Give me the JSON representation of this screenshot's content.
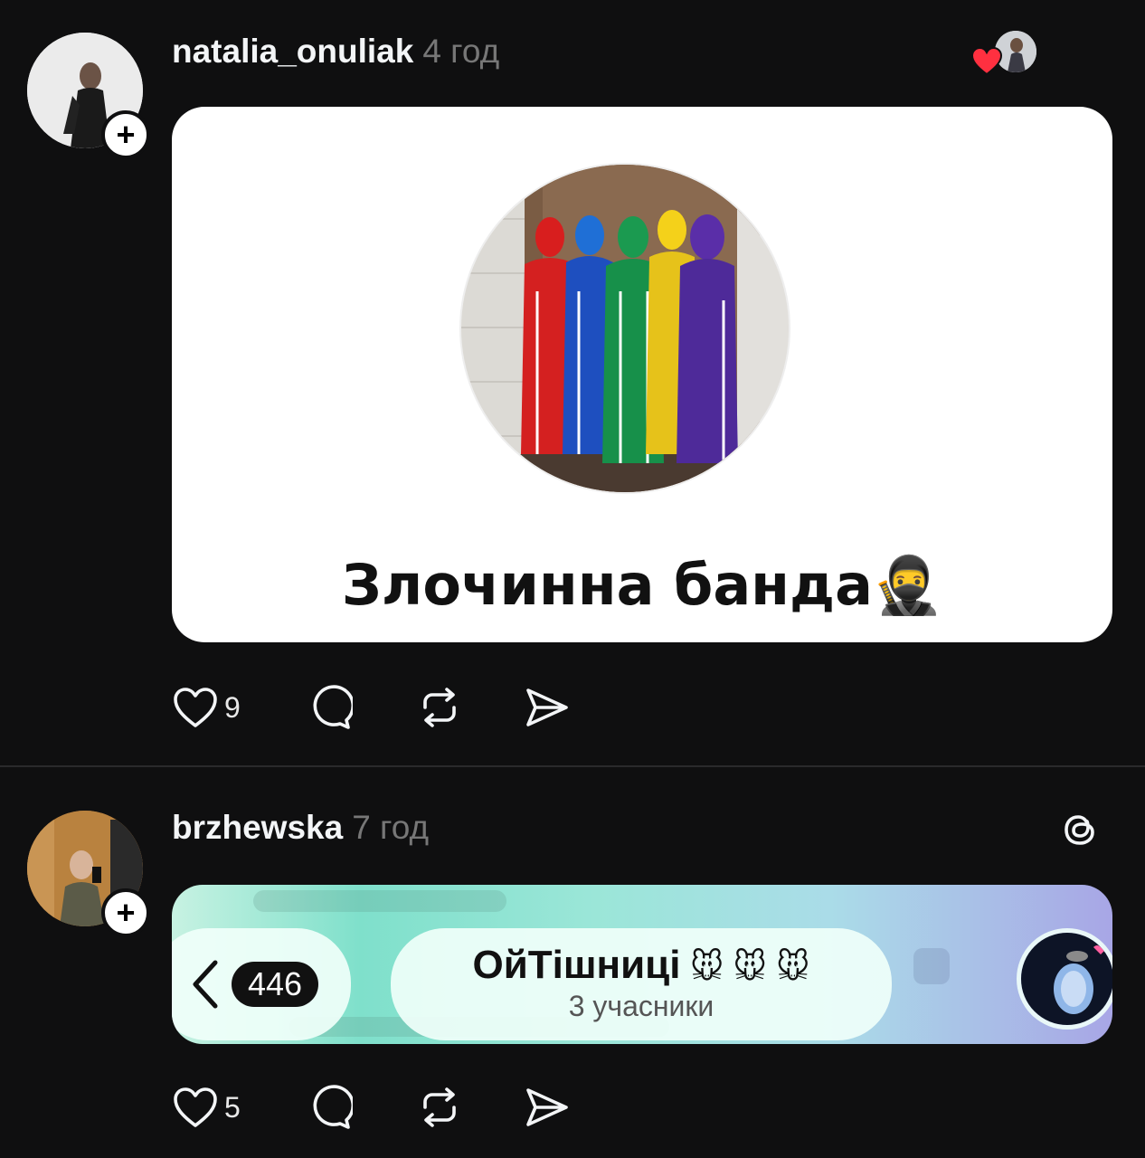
{
  "posts": [
    {
      "username": "natalia_onuliak",
      "time": "4 год",
      "image_caption": "Злочинна банда",
      "image_caption_emoji": "🥷",
      "likes": "9",
      "actions": [
        "heart-icon",
        "comment-icon",
        "repost-icon",
        "share-icon"
      ],
      "reaction_icon": "heart-icon",
      "reaction_color": "#ff3040"
    },
    {
      "username": "brzhewska",
      "time": "7 год",
      "app_icon": "threads-icon",
      "chat": {
        "back_count": "446",
        "title": "ОйТішниці",
        "title_emoji": "🐭 🐭 🐭",
        "subtitle": "3 учасники"
      },
      "likes": "5",
      "actions": [
        "heart-icon",
        "comment-icon",
        "repost-icon",
        "share-icon"
      ]
    }
  ],
  "colors": {
    "background": "#0f0f10",
    "time_text": "#777777",
    "username_text": "#f3f5f7",
    "divider": "#2a2a2c"
  }
}
